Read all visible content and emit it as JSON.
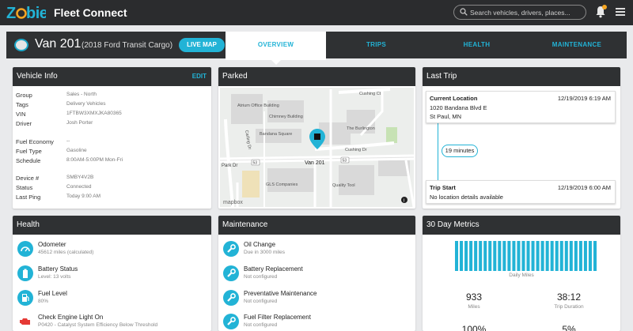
{
  "app": {
    "logo_text": "Zobie",
    "title": "Fleet Connect"
  },
  "search": {
    "placeholder": "Search vehicles, drivers, places..."
  },
  "vehicle": {
    "name": "Van 201",
    "model": "(2018 Ford Transit Cargo)",
    "live_map_label": "LIVE MAP"
  },
  "tabs": [
    {
      "label": "OVERVIEW",
      "active": true
    },
    {
      "label": "TRIPS",
      "active": false
    },
    {
      "label": "HEALTH",
      "active": false
    },
    {
      "label": "MAINTENANCE",
      "active": false
    }
  ],
  "vehicle_info": {
    "title": "Vehicle Info",
    "edit_label": "EDIT",
    "fields": [
      {
        "key": "Group",
        "value": "Sales - North"
      },
      {
        "key": "Tags",
        "value": "Delivery Vehicles"
      },
      {
        "key": "VIN",
        "value": "1FTBW3XMXJKA80365"
      },
      {
        "key": "Driver",
        "value": "Josh Porter"
      },
      {
        "key": "Fuel Economy",
        "value": "--"
      },
      {
        "key": "Fuel Type",
        "value": "Gasoline"
      },
      {
        "key": "Schedule",
        "value": "8:00AM-5:00PM Mon-Fri"
      },
      {
        "key": "Device #",
        "value": "SMBY4V2B"
      },
      {
        "key": "Status",
        "value": "Connected"
      },
      {
        "key": "Last Ping",
        "value": "Today 9:00 AM"
      }
    ]
  },
  "parked": {
    "title": "Parked",
    "map_labels": {
      "cushing_ct": "Cushing Ct",
      "atrium": "Atrium Office Building",
      "chimney": "Chimney Building",
      "bandana_square": "Bandana Square",
      "burlington": "The Burlington",
      "carling": "Carling Dr",
      "cushing_dr": "Cushing Dr",
      "park_dr": "Park Dr",
      "route_53_a": "53",
      "route_53_b": "53",
      "van": "Van 201",
      "gls": "GLS Companies",
      "quality": "Quality Tool",
      "mapbox": "mapbox",
      "info": "i"
    }
  },
  "last_trip": {
    "title": "Last Trip",
    "current_label": "Current Location",
    "current_date": "12/19/2019 6:19 AM",
    "current_address_1": "1020 Bandana Blvd E",
    "current_address_2": "St Paul, MN",
    "duration": "19 minutes",
    "start_label": "Trip Start",
    "start_date": "12/19/2019 6:00 AM",
    "start_address": "No location details available"
  },
  "health": {
    "title": "Health",
    "items": [
      {
        "title": "Odometer",
        "sub": "45612 miles (calculated)",
        "icon": "speedometer-icon"
      },
      {
        "title": "Battery Status",
        "sub": "Level: 13 volts",
        "icon": "battery-icon"
      },
      {
        "title": "Fuel Level",
        "sub": "80%",
        "icon": "fuel-pump-icon"
      },
      {
        "title": "Check Engine Light On",
        "sub": "P0420 - Catalyst System Efficiency Below Threshold",
        "icon": "engine-icon"
      }
    ]
  },
  "maintenance": {
    "title": "Maintenance",
    "items": [
      {
        "title": "Oil Change",
        "sub": "Due in 3000 miles",
        "icon": "wrench-icon"
      },
      {
        "title": "Battery Replacement",
        "sub": "Not configured",
        "icon": "wrench-icon"
      },
      {
        "title": "Preventative Maintenance",
        "sub": "Not configured",
        "icon": "wrench-icon"
      },
      {
        "title": "Fuel Filter Replacement",
        "sub": "Not configured",
        "icon": "wrench-icon"
      }
    ]
  },
  "metrics": {
    "title": "30 Day Metrics",
    "bar_count": 30,
    "chart_label": "Daily Miles",
    "miles_value": "933",
    "miles_label": "Miles",
    "duration_value": "38:12",
    "duration_label": "Trip Duration",
    "partial_left": "100%",
    "partial_right": "5%"
  },
  "colors": {
    "accent": "#22b3d6",
    "header": "#2f3133",
    "topbar": "#2b2c2e",
    "warning": "#e53935"
  }
}
